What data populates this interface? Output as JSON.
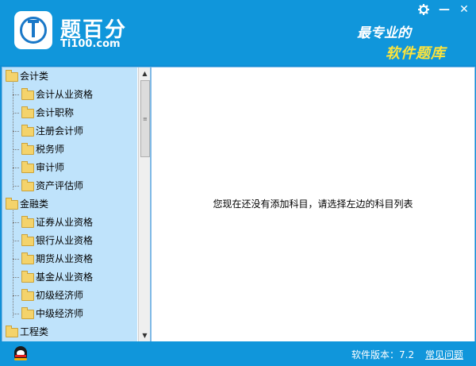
{
  "app": {
    "name": "题百分",
    "url": "Ti100.com",
    "slogan_line1": "最专业的",
    "slogan_line2": "软件题库"
  },
  "window_controls": {
    "settings_icon": "gear-icon",
    "minimize": "—",
    "close": "✕"
  },
  "sidebar": {
    "categories": [
      {
        "label": "会计类",
        "items": [
          "会计从业资格",
          "会计职称",
          "注册会计师",
          "税务师",
          "审计师",
          "资产评估师"
        ]
      },
      {
        "label": "金融类",
        "items": [
          "证券从业资格",
          "银行从业资格",
          "期货从业资格",
          "基金从业资格",
          "初级经济师",
          "中级经济师"
        ]
      },
      {
        "label": "工程类",
        "items": []
      }
    ],
    "scroll_up": "▲",
    "scroll_down": "▼",
    "scroll_grip": "≡"
  },
  "main": {
    "message": "您现在还没有添加科目，请选择左边的科目列表"
  },
  "status_bar": {
    "version_label": "软件版本：7.2",
    "faq_link": "常见问题"
  },
  "colors": {
    "header_blue": "#1096db",
    "tree_bg": "#bfe3fb",
    "slogan_yellow": "#ffe43a"
  }
}
